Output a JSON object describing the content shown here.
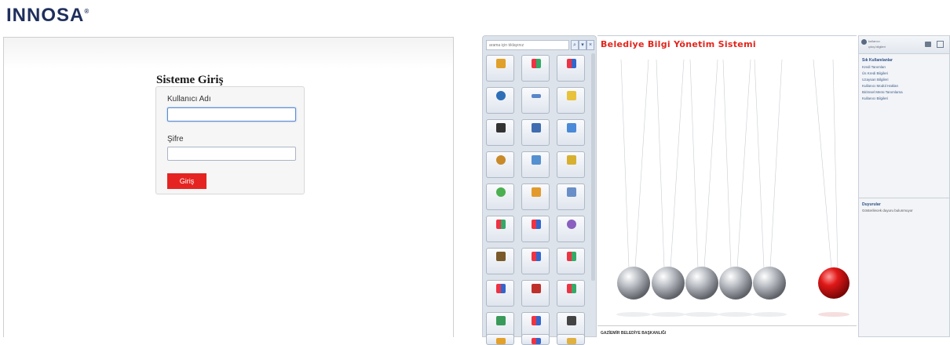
{
  "brand": {
    "logo_text": "INNOSA",
    "logo_mark": "®"
  },
  "login": {
    "title": "Sisteme Giriş",
    "username_label": "Kullanıcı Adı",
    "username_value": "",
    "password_label": "Şifre",
    "password_value": "",
    "submit_label": "Giriş"
  },
  "app": {
    "title": "Belediye Bilgi Yönetim Sistemi",
    "search": {
      "placeholder": "arama için tıklayınız"
    },
    "footer_text": "GAZİEMİR BELEDİYE BAŞKANLIĞI",
    "user": {
      "line1": "kullanıcı",
      "line2": "çıkış bilgileri"
    },
    "shortcuts": {
      "title": "Sık Kullanılanlar",
      "items": [
        "Kredi Tanımları",
        "Üs Kredi Bilgileri",
        "Uzaysarı Bilgileri",
        "Kullanıcı Modül Hakları",
        "Birimsel Menü Tanımlama",
        "Kullanıcı Bilgileri"
      ]
    },
    "announcements": {
      "title": "Duyurular",
      "text": "Gösterilecek duyuru bulunmuyor"
    }
  },
  "colors": {
    "accent_red": "#e52421",
    "title_red": "#e0261d",
    "brand_navy": "#1f2f5c"
  }
}
